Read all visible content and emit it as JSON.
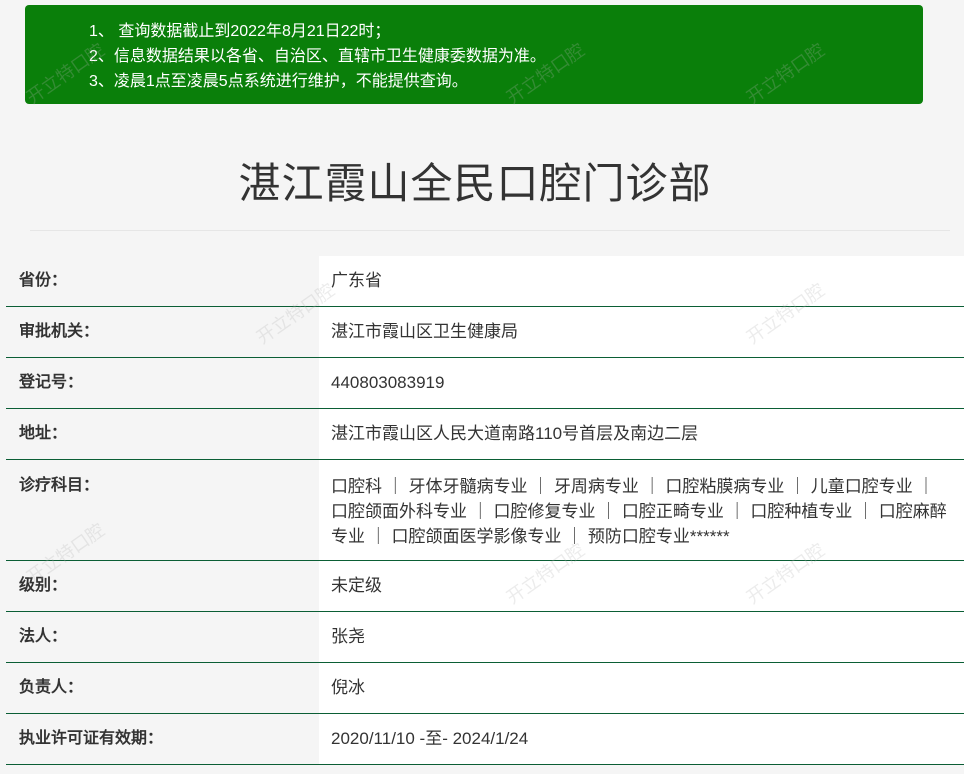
{
  "notice": {
    "items": [
      "1、 查询数据截止到2022年8月21日22时；",
      "2、信息数据结果以各省、自治区、直辖市卫生健康委数据为准。",
      "3、凌晨1点至凌晨5点系统进行维护，不能提供查询。"
    ],
    "background": "#0a7f0a"
  },
  "page_title": "湛江霞山全民口腔门诊部",
  "info": {
    "rows": [
      {
        "label": "省份：",
        "value": "广东省"
      },
      {
        "label": "审批机关：",
        "value": "湛江市霞山区卫生健康局"
      },
      {
        "label": "登记号：",
        "value": "440803083919"
      },
      {
        "label": "地址：",
        "value": "湛江市霞山区人民大道南路110号首层及南边二层"
      },
      {
        "label": "诊疗科目：",
        "value": "口腔科 ｜ 牙体牙髓病专业 ｜ 牙周病专业 ｜ 口腔粘膜病专业 ｜ 儿童口腔专业 ｜ 口腔颌面外科专业 ｜ 口腔修复专业 ｜ 口腔正畸专业 ｜ 口腔种植专业 ｜ 口腔麻醉专业 ｜ 口腔颌面医学影像专业 ｜ 预防口腔专业******"
      },
      {
        "label": "级别：",
        "value": "未定级"
      },
      {
        "label": "法人：",
        "value": "张尧"
      },
      {
        "label": "负责人：",
        "value": "倪冰"
      },
      {
        "label": "执业许可证有效期：",
        "value": "2020/11/10 -至- 2024/1/24"
      }
    ]
  },
  "watermark": "开立特口腔"
}
